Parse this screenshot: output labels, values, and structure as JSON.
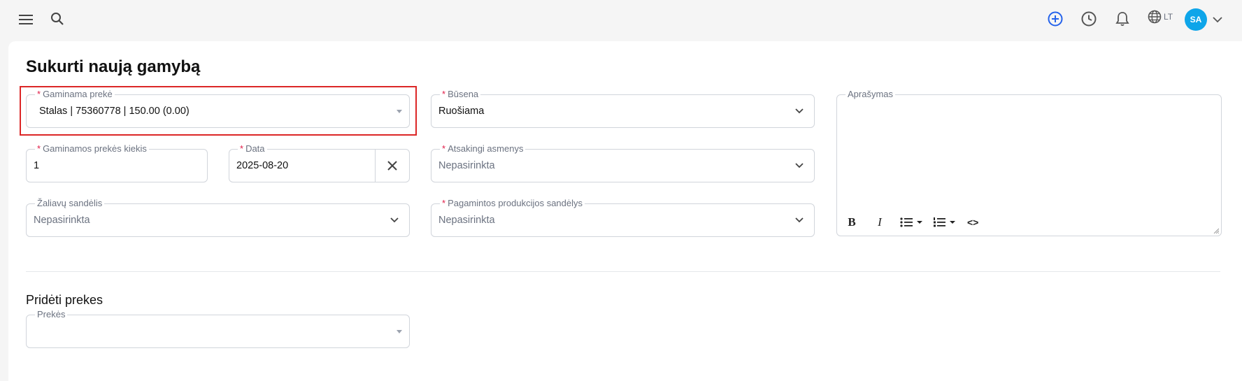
{
  "header": {
    "lang": "LT",
    "avatar_initials": "SA",
    "icons": [
      "menu-icon",
      "search-icon",
      "plus-circle-icon",
      "clock-icon",
      "bell-icon",
      "globe-icon",
      "chevron-down-icon"
    ],
    "accent": "#2563eb",
    "avatar_color": "#0ea5e9"
  },
  "page": {
    "title": "Sukurti naują gamybą"
  },
  "form": {
    "product": {
      "label": "Gaminama prekė",
      "value": "Stalas | 75360778 | 150.00 (0.00)",
      "required": true
    },
    "status": {
      "label": "Būsena",
      "value": "Ruošiama",
      "required": true
    },
    "description": {
      "label": "Aprašymas"
    },
    "quantity": {
      "label": "Gaminamos prekės kiekis",
      "value": "1",
      "required": true
    },
    "date": {
      "label": "Data",
      "value": "2025-08-20",
      "required": true
    },
    "responsible": {
      "label": "Atsakingi asmenys",
      "value": "Nepasirinkta",
      "required": true
    },
    "raw_warehouse": {
      "label": "Žaliavų sandėlis",
      "value": "Nepasirinkta"
    },
    "output_warehouse": {
      "label": "Pagamintos produkcijos sandėlys",
      "value": "Nepasirinkta",
      "required": true
    }
  },
  "add_products": {
    "title": "Pridėti prekes",
    "products_label": "Prekės",
    "products_value": ""
  },
  "editor_toolbar": {
    "bold": "B",
    "italic": "I",
    "code": "<>"
  },
  "required_marker": "*",
  "highlight_color": "#dc2626"
}
